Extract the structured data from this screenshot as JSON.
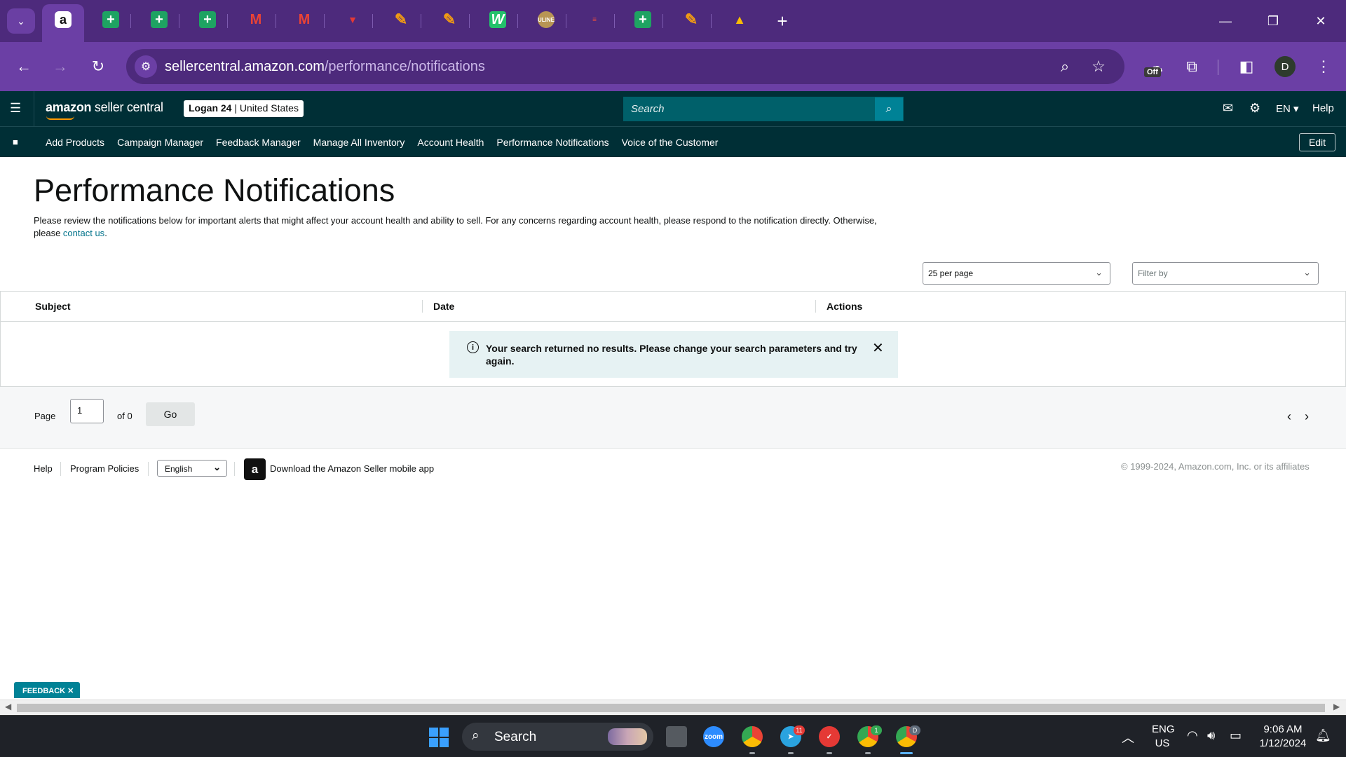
{
  "browser": {
    "url_host": "sellercentral.amazon.com",
    "url_path": "/performance/notifications",
    "new_tab_label": "+",
    "extension_badge": "Off",
    "profile_initial": "D",
    "tabs": [
      {
        "icon": "amazon-icon",
        "glyph": "a"
      },
      {
        "icon": "google-sheets-icon",
        "glyph": "+"
      },
      {
        "icon": "google-sheets-icon",
        "glyph": "+"
      },
      {
        "icon": "google-sheets-icon",
        "glyph": "+"
      },
      {
        "icon": "gmail-icon",
        "glyph": "M"
      },
      {
        "icon": "gmail-icon",
        "glyph": "M"
      },
      {
        "icon": "red-logo-icon",
        "glyph": "▼"
      },
      {
        "icon": "pen-icon",
        "glyph": "✎"
      },
      {
        "icon": "pen-icon",
        "glyph": "✎"
      },
      {
        "icon": "w-app-icon",
        "glyph": "W"
      },
      {
        "icon": "uline-icon",
        "glyph": "ULINE"
      },
      {
        "icon": "bars-icon",
        "glyph": "≡"
      },
      {
        "icon": "google-sheets-icon",
        "glyph": "+"
      },
      {
        "icon": "pen-icon",
        "glyph": "✎"
      },
      {
        "icon": "google-drive-icon",
        "glyph": "▲"
      }
    ]
  },
  "header": {
    "logo_bold": "amazon",
    "logo_rest": " seller central",
    "account_name": "Logan 24",
    "account_sep": " | ",
    "account_region": "United States",
    "search_placeholder": "Search",
    "language": "EN",
    "help": "Help"
  },
  "nav": {
    "items": [
      "Add Products",
      "Campaign Manager",
      "Feedback Manager",
      "Manage All Inventory",
      "Account Health",
      "Performance Notifications",
      "Voice of the Customer"
    ],
    "edit_label": "Edit"
  },
  "main": {
    "title": "Performance Notifications",
    "description": "Please review the notifications below for important alerts that might affect your account health and ability to sell. For any concerns regarding account health, please respond to the notification directly. Otherwise, please ",
    "contact_link": "contact us",
    "description_end": ".",
    "per_page": "25 per page",
    "filter_placeholder": "Filter by",
    "columns": [
      "Subject",
      "Date",
      "Actions"
    ],
    "alert_text": "Your search returned no results. Please change your search parameters and try again."
  },
  "pager": {
    "page_label": "Page",
    "page_value": "1",
    "of_label": "of 0",
    "go_label": "Go"
  },
  "footer": {
    "help": "Help",
    "program_policies": "Program Policies",
    "language": "English",
    "app_link": "Download the Amazon Seller mobile app",
    "copyright": "© 1999-2024, Amazon.com, Inc. or its affiliates"
  },
  "feedback_label": "FEEDBACK",
  "taskbar": {
    "search_label": "Search",
    "lang_top": "ENG",
    "lang_bottom": "US",
    "time": "9:06 AM",
    "date": "1/12/2024",
    "telegram_badge": "11",
    "chrome_badge": "1",
    "profile_badge": "D",
    "zoom_label": "zoom"
  },
  "colors": {
    "chrome_purple": "#6b3fa5",
    "seller_header": "#002f36",
    "link_teal": "#00728a",
    "alert_bg": "#e6f2f3"
  }
}
